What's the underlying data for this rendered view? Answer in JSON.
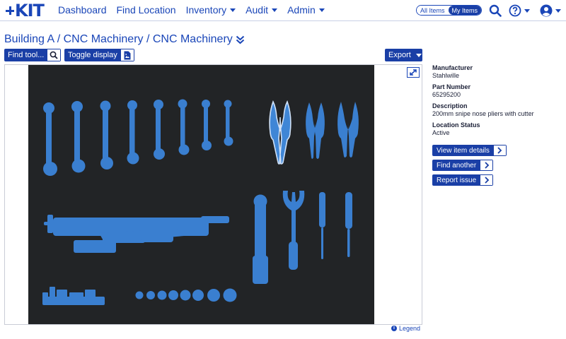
{
  "nav": {
    "logo_text": "KIT",
    "links": [
      {
        "label": "Dashboard",
        "dropdown": false
      },
      {
        "label": "Find Location",
        "dropdown": false
      },
      {
        "label": "Inventory",
        "dropdown": true
      },
      {
        "label": "Audit",
        "dropdown": true
      },
      {
        "label": "Admin",
        "dropdown": true
      }
    ],
    "scope": {
      "all_items": "All Items",
      "my_items": "My Items",
      "selected": "My Items"
    },
    "icons": [
      "search-icon",
      "help-icon",
      "user-icon"
    ]
  },
  "breadcrumb": {
    "text": "Building A / CNC Machinery / CNC Machinery"
  },
  "toolbar": {
    "find_tool": "Find tool...",
    "toggle_display": "Toggle display",
    "export": "Export"
  },
  "board": {
    "legend": "Legend"
  },
  "detail": {
    "manufacturer_label": "Manufacturer",
    "manufacturer": "Stahlwille",
    "part_number_label": "Part Number",
    "part_number": "65295200",
    "description_label": "Description",
    "description": "200mm snipe nose pliers with cutter",
    "status_label": "Location Status",
    "status": "Active",
    "view_details": "View item details",
    "find_another": "Find another",
    "report_issue": "Report issue"
  },
  "colors": {
    "brand": "#1a46b8",
    "button": "#1a3fa6",
    "board": "#222426",
    "tool": "#3a7fd0",
    "tool_selected": "#3f86d6"
  }
}
